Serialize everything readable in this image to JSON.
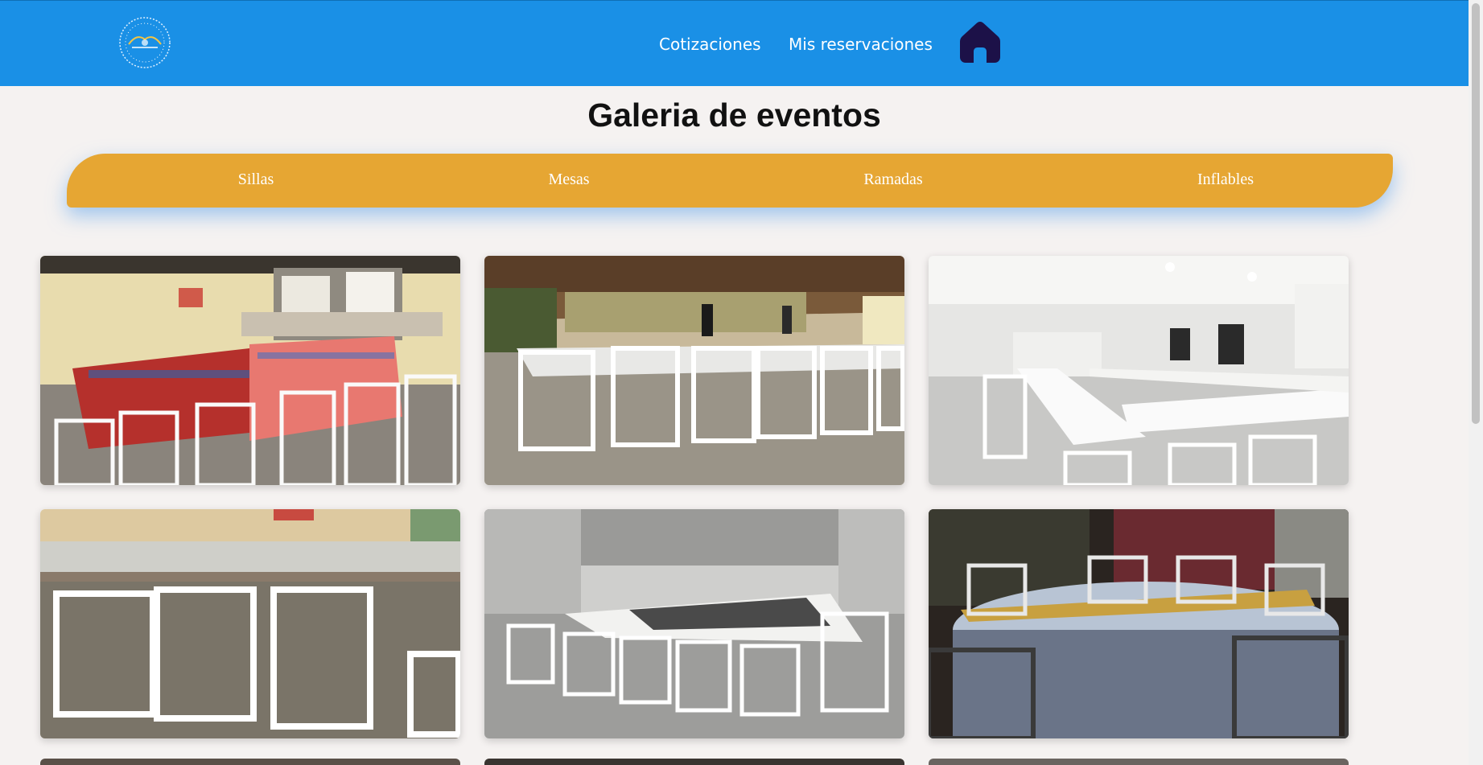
{
  "header": {
    "logo_icon": "circular-brand-logo-icon",
    "nav": [
      {
        "label": "Cotizaciones"
      },
      {
        "label": "Mis reservaciones"
      }
    ],
    "home_icon": "home-icon",
    "colors": {
      "bar": "#1a90e6",
      "home_icon": "#1c1148"
    }
  },
  "page": {
    "title": "Galeria de eventos"
  },
  "categories": {
    "color": "#e6a633",
    "items": [
      {
        "label": "Sillas"
      },
      {
        "label": "Mesas"
      },
      {
        "label": "Ramadas"
      },
      {
        "label": "Inflables"
      }
    ]
  },
  "gallery": {
    "photos": [
      {
        "subject": "indoor-patio-with-red-tablecloths-and-white-chairs"
      },
      {
        "subject": "outdoor-ramada-with-long-tables-and-white-chairs"
      },
      {
        "subject": "white-hall-with-u-shaped-tables"
      },
      {
        "subject": "close-up-white-tiffany-chairs-at-long-table"
      },
      {
        "subject": "white-hall-with-rectangular-table-layout"
      },
      {
        "subject": "round-table-with-gold-runner-and-chairs"
      }
    ]
  }
}
